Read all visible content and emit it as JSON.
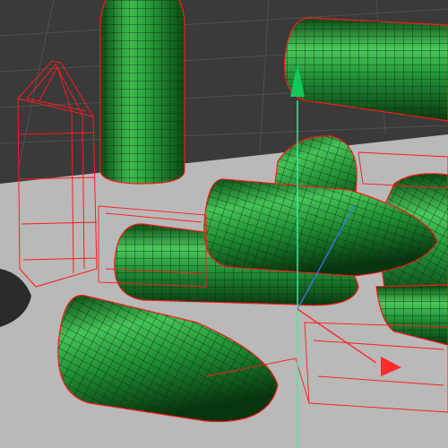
{
  "viewport": {
    "colors": {
      "background_dark": "#3a3a3a",
      "ground_plane": "#b9b9b9",
      "grid_line": "#505050",
      "mesh_fill": "#1d8a2e",
      "mesh_fill_light": "#5fd36d",
      "mesh_fill_dark": "#0a4a14",
      "mesh_wire": "#0b2a10",
      "selection_wire": "#ff1a1a",
      "gizmo_y_axis": "#3df0a0",
      "gizmo_x_axis": "#ff2a2a",
      "gizmo_z_axis": "#3a7bff",
      "unselected_object": "#2b2b2b"
    },
    "objects": [
      {
        "kind": "bullet",
        "state": "selected"
      },
      {
        "kind": "bullet",
        "state": "selected"
      },
      {
        "kind": "bullet",
        "state": "selected"
      },
      {
        "kind": "bullet",
        "state": "selected"
      },
      {
        "kind": "bullet",
        "state": "selected"
      },
      {
        "kind": "bullet",
        "state": "selected"
      },
      {
        "kind": "bullet",
        "state": "selected"
      },
      {
        "kind": "bullet",
        "state": "selected"
      },
      {
        "kind": "bullet",
        "state": "wireframe-only"
      },
      {
        "kind": "bullet",
        "state": "unselected"
      }
    ],
    "gizmo": {
      "type": "move-transform",
      "axes": [
        "y",
        "x",
        "z"
      ]
    }
  }
}
